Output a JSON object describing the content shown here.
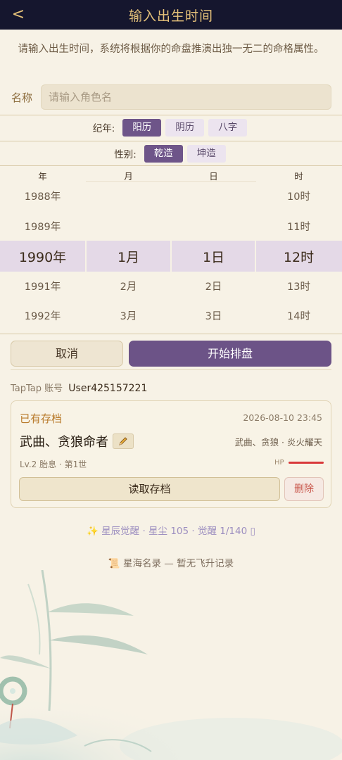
{
  "header": {
    "back": "<",
    "title": "输入出生时间"
  },
  "intro": "请输入出生时间，系统将根据你的命盘推演出独一无二的命格属性。",
  "name": {
    "label": "名称",
    "placeholder": "请输入角色名",
    "value": ""
  },
  "calendar": {
    "label": "纪年:",
    "options": [
      "阳历",
      "阴历",
      "八字"
    ],
    "selected": "阳历"
  },
  "gender": {
    "label": "性别:",
    "options": [
      "乾造",
      "坤造"
    ],
    "selected": "乾造"
  },
  "picker": {
    "headers": [
      "年",
      "月",
      "日",
      "时"
    ],
    "year": [
      "1988年",
      "1989年",
      "1990年",
      "1991年",
      "1992年"
    ],
    "month": [
      "",
      "",
      "1月",
      "2月",
      "3月"
    ],
    "day": [
      "",
      "",
      "1日",
      "2日",
      "3日"
    ],
    "hour": [
      "10时",
      "11时",
      "12时",
      "13时",
      "14时"
    ],
    "selected_index": 2
  },
  "actions": {
    "cancel": "取消",
    "start": "开始排盘"
  },
  "account": {
    "label": "TapTap 账号",
    "user_id": "User425157221"
  },
  "save": {
    "title": "已有存档",
    "date": "2026-08-10 23:45",
    "character": "武曲、贪狼命者",
    "edit_icon": "pencil-icon",
    "tags": "武曲、贪狼 · 炎火耀天",
    "level": "Lv.2 胎息 · 第1世",
    "hp_label": "HP",
    "hp_fraction": 1.0,
    "hp_color": "#d9383a",
    "load": "读取存档",
    "delete": "删除"
  },
  "stars": {
    "text": "✨ 星辰觉醒 · 星尘 105 · 觉醒 1/140 ▯"
  },
  "fame": {
    "text": "📜 星海名录 — 暂无飞升记录"
  },
  "colors": {
    "accent": "#6c5387",
    "header_bg": "#15162e",
    "gold": "#e6c27a"
  }
}
